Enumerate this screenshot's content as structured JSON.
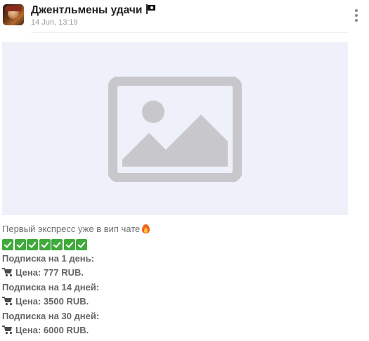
{
  "post": {
    "channel_name": "Джентльмены удачи",
    "timestamp": "14 Jun, 13:19",
    "flag_icon": "pirate-flag-icon",
    "more_icon": "more-vertical-icon",
    "media": {
      "icon": "image-placeholder-icon",
      "background_color": "#eef1f9",
      "icon_color": "#c8c8cc"
    },
    "lines": {
      "intro": "Первый экспресс уже в вип чате",
      "intro_emoji": "fire-icon",
      "check_count": 7,
      "check_color": "#3faa3a",
      "sub_1_day": "Подписка на 1 день:",
      "price_1": "Цена: 777 RUB.",
      "sub_14_days": "Подписка на 14 дней:",
      "price_14": "Цена: 3500 RUB.",
      "sub_30_days": "Подписка на 30 дней:",
      "price_30": "Цена: 6000 RUB."
    }
  }
}
